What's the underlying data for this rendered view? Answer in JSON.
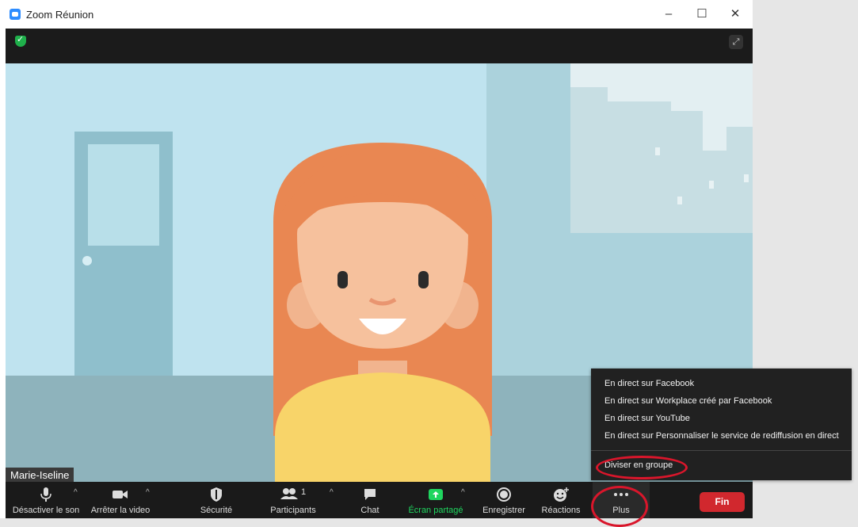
{
  "window": {
    "title": "Zoom Réunion",
    "controls": {
      "minimize": "–",
      "maximize": "☐",
      "close": "✕"
    }
  },
  "video": {
    "participant_name": "Marie-Iseline"
  },
  "toolbar": {
    "items": [
      {
        "label": "Désactiver le son"
      },
      {
        "label": "Arrêter la video"
      },
      {
        "label": "Sécurité"
      },
      {
        "label": "Participants",
        "count": "1"
      },
      {
        "label": "Chat"
      },
      {
        "label": "Écran partagé"
      },
      {
        "label": "Enregistrer"
      },
      {
        "label": "Réactions"
      },
      {
        "label": "Plus"
      }
    ],
    "end_button": "Fin"
  },
  "more_menu": {
    "items": [
      "En direct sur Facebook",
      "En direct sur Workplace créé par Facebook",
      "En direct sur YouTube",
      "En direct sur Personnaliser le service de rediffusion en direct",
      "Diviser en groupe"
    ]
  },
  "colors": {
    "accent_green": "#1fd55f",
    "end_red": "#d1282e",
    "highlight_ring": "#d9162b"
  }
}
